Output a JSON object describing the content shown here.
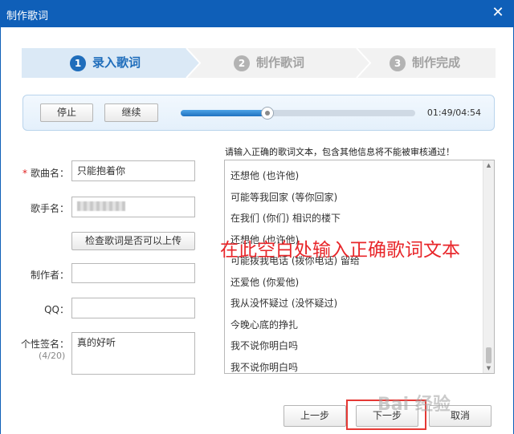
{
  "window": {
    "title": "制作歌词",
    "close_glyph": "✕",
    "brand_color": "#0f5fb8"
  },
  "steps": [
    {
      "number": "1",
      "label": "录入歌词",
      "active": true
    },
    {
      "number": "2",
      "label": "制作歌词",
      "active": false
    },
    {
      "number": "3",
      "label": "制作完成",
      "active": false
    }
  ],
  "player": {
    "stop_label": "停止",
    "continue_label": "继续",
    "progress": 0.37,
    "time": "01:49/04:54"
  },
  "form": {
    "song_label": "歌曲名：",
    "song_value": "只能抱着你",
    "singer_label": "歌手名：",
    "check_button": "检查歌词是否可以上传",
    "author_label": "制作者：",
    "qq_label": "QQ：",
    "signature_label": "个性签名：",
    "signature_value": "真的好听",
    "signature_count": "(4/20)"
  },
  "lyrics": {
    "instruction": "请输入正确的歌词文本，包含其他信息将不能被审核通过！",
    "lines": [
      "还想他 (也许他)",
      "可能等我回家 (等你回家)",
      "在我们 (你们) 相识的楼下",
      "还想他 (也许他)",
      "可能拨我电话 (拨你电话) 留给",
      "还爱他 (你爱他)",
      "我从没怀疑过 (没怀疑过)",
      "今晚心底的挣扎",
      "我不说你明白吗",
      "我不说你明白吗"
    ]
  },
  "overlay": {
    "text": "在此空白处输入正确歌词文本",
    "color": "#e8262a"
  },
  "buttons": {
    "prev": "上一步",
    "next": "下一步",
    "cancel": "取消"
  },
  "watermark": "Bai 经验"
}
